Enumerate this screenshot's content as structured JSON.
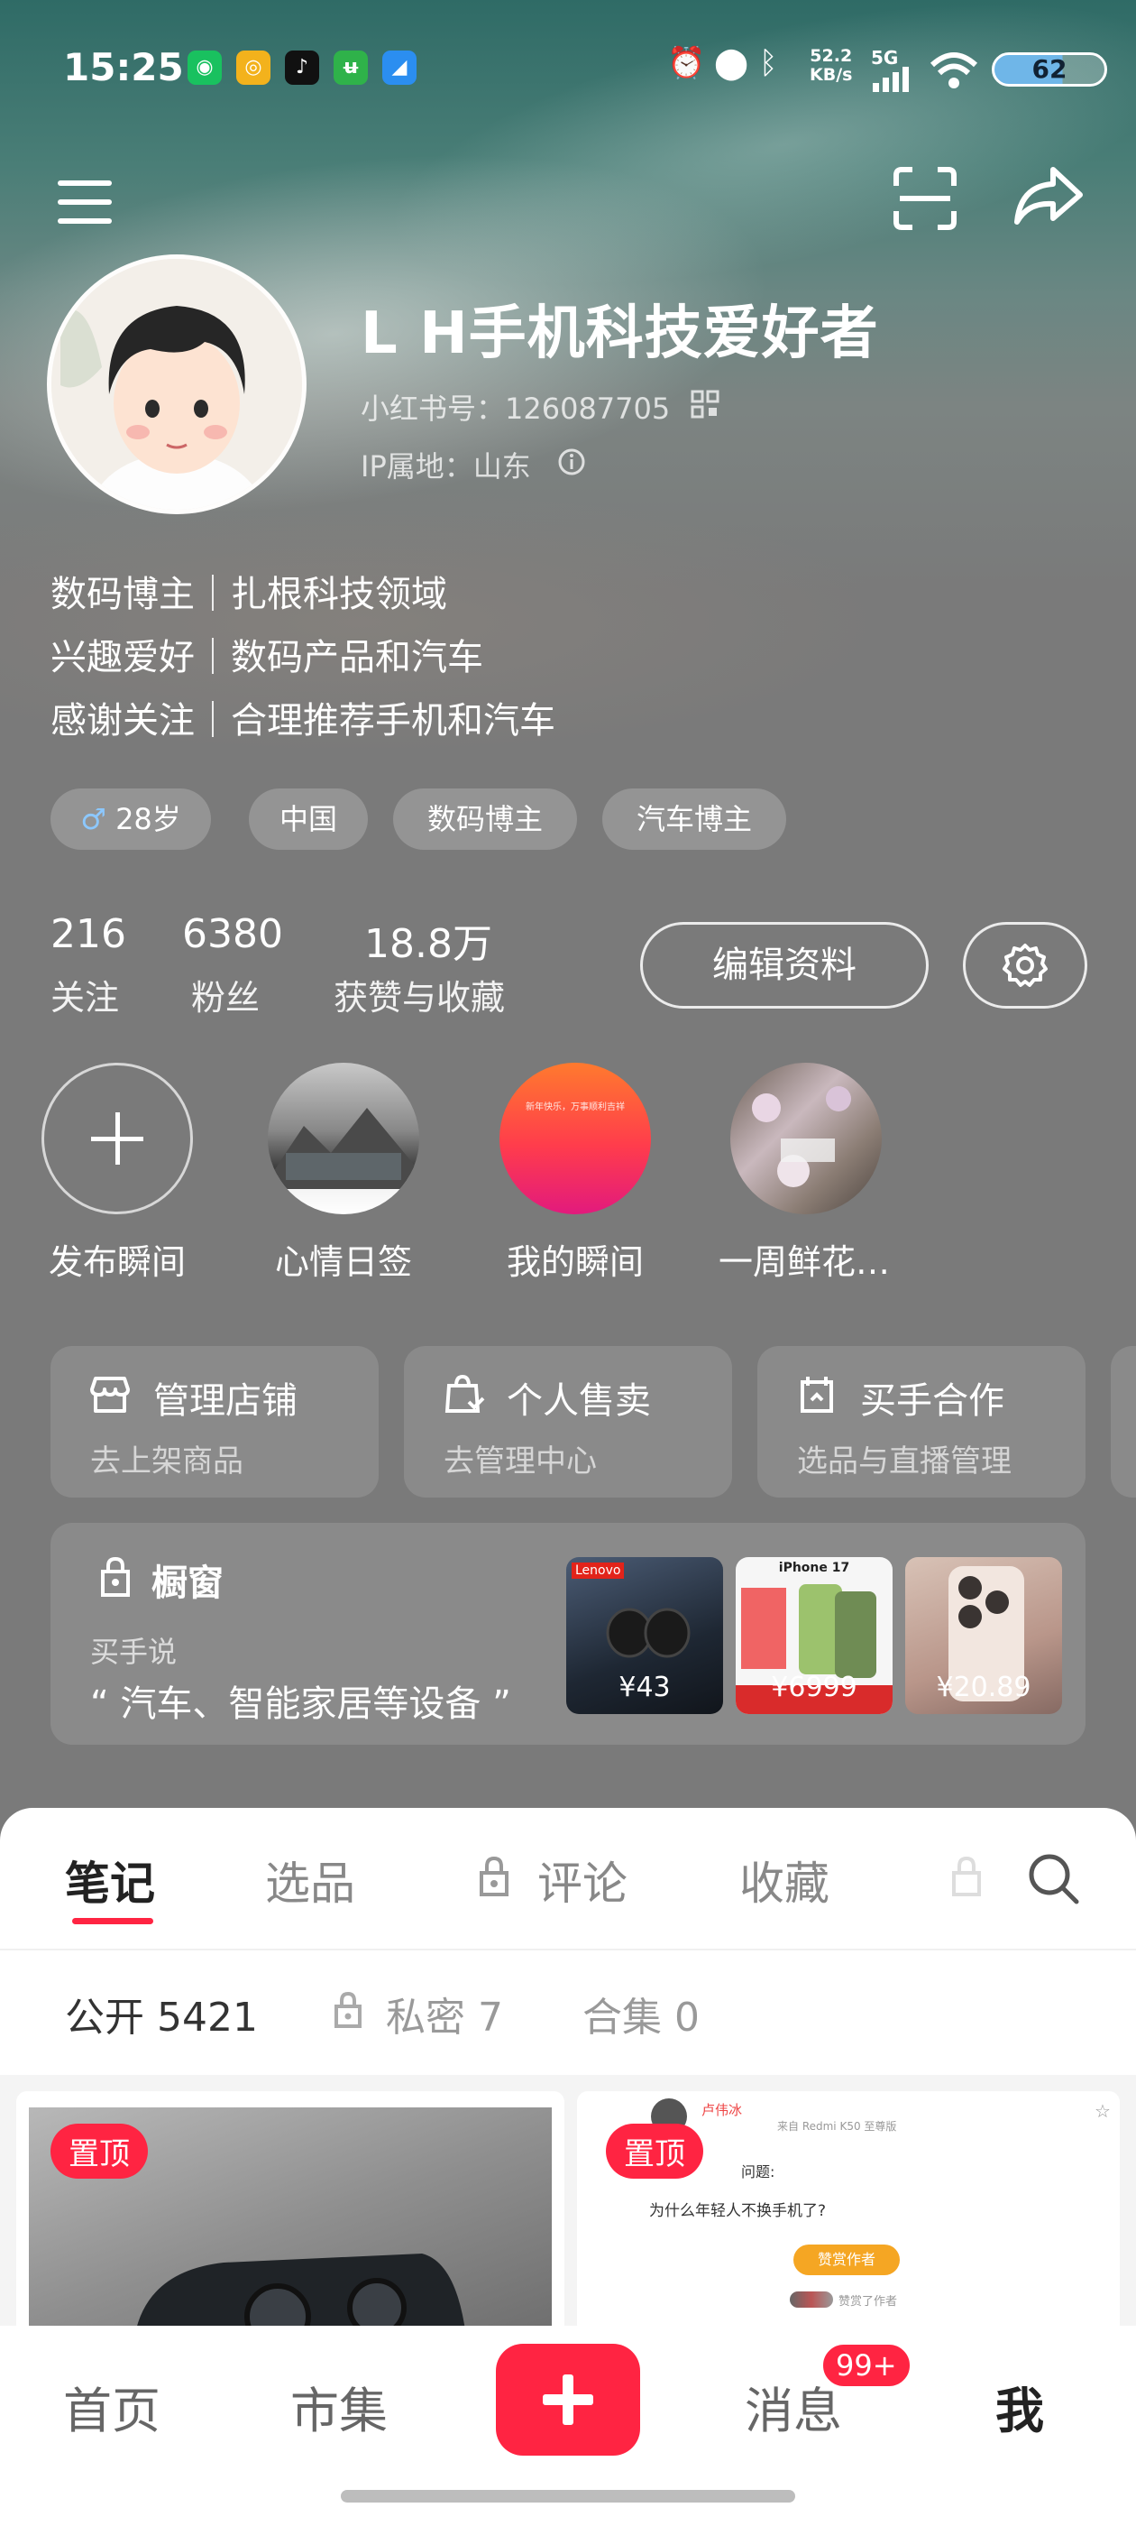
{
  "status": {
    "time": "15:25",
    "speed_value": "52.2",
    "speed_unit": "KB/s",
    "network": "5G",
    "battery": "62"
  },
  "profile": {
    "name": "L H手机科技爱好者",
    "red_id": "小红书号：126087705",
    "ip": "IP属地：山东",
    "bio": [
      "数码博主｜扎根科技领域",
      "兴趣爱好｜数码产品和汽车",
      "感谢关注｜合理推荐手机和汽车"
    ],
    "tags": [
      "28岁",
      "中国",
      "数码博主",
      "汽车博主"
    ]
  },
  "stats": [
    {
      "value": "216",
      "label": "关注"
    },
    {
      "value": "6380",
      "label": "粉丝"
    },
    {
      "value": "18.8万",
      "label": "获赞与收藏"
    }
  ],
  "actions": {
    "edit": "编辑资料"
  },
  "moments": [
    {
      "label": "发布瞬间"
    },
    {
      "label": "心情日签"
    },
    {
      "label": "我的瞬间",
      "inner_text": "新年快乐，万事顺利吉祥"
    },
    {
      "label": "一周鲜花…"
    }
  ],
  "cards": [
    {
      "title": "管理店铺",
      "sub": "去上架商品"
    },
    {
      "title": "个人售卖",
      "sub": "去管理中心"
    },
    {
      "title": "买手合作",
      "sub": "选品与直播管理"
    }
  ],
  "window": {
    "title": "橱窗",
    "buyer_label": "买手说",
    "quote": "“ 汽车、智能家居等设备 ”",
    "products": [
      {
        "price": "¥43",
        "brand": "Lenovo"
      },
      {
        "price": "¥6999",
        "brand": "iPhone 17"
      },
      {
        "price": "¥20.89"
      }
    ]
  },
  "tabs": [
    "笔记",
    "选品",
    "评论",
    "收藏"
  ],
  "subtabs": [
    "公开 5421",
    "私密 7",
    "合集 0"
  ],
  "notes": {
    "pin": "置顶",
    "n2_user": "卢伟冰",
    "n2_meta": "来自 Redmi K50 至尊版",
    "n2_question": "问题:",
    "n2_text": "为什么年轻人不换手机了?",
    "n2_btn": "赞赏作者",
    "n2_footer": "赞赏了作者"
  },
  "nav": {
    "home": "首页",
    "market": "市集",
    "messages": "消息",
    "me": "我",
    "badge": "99+"
  }
}
